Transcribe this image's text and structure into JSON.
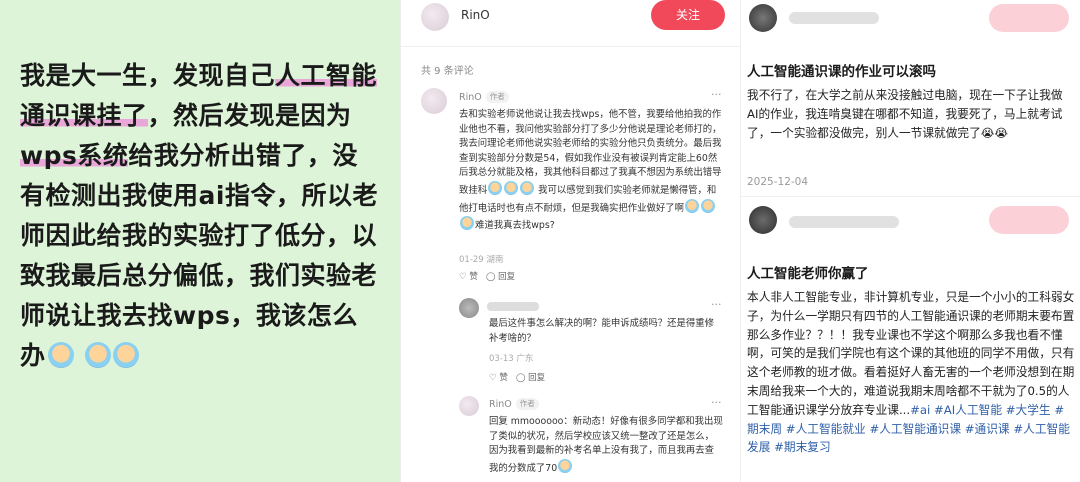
{
  "left_panel": {
    "parts": [
      {
        "t": "我是大一生，发现自己",
        "hl": false
      },
      {
        "t": "人工智能通识课挂了",
        "hl": true
      },
      {
        "t": "，然后发现是因为",
        "hl": false
      },
      {
        "t": "wps系统",
        "hl": true
      },
      {
        "t": "给我分析出错了，没有检测出我使用ai指令，所以老师因此给我的实验打了低分，以致我最后总分偏低，我们实验老师说让我去找wps，我该怎么办",
        "hl": false
      }
    ]
  },
  "middle": {
    "author": "RinO",
    "follow_label": "关注",
    "comment_count": "共 9 条评论",
    "comments": [
      {
        "name": "RinO",
        "tag": "作者",
        "body": "去和实验老师说他说让我去找wps，他不管，我要给他拍我的作业他也不看，我问他实验部分打了多少分他说是理论老师打的，我去问理论老师他说实验老师给的实验分他只负责统分。最后我查到实验部分分数是54，假如我作业没有被误判肯定能上60然后我总分就能及格，我其他科目都过了我真不想因为系统出错导致挂科",
        "body2": "我可以感觉到我们实验老师就是懒得管，和他打电话时也有点不耐烦，但是我确实把作业做好了啊",
        "body3": "难道我真去找wps?",
        "meta": "01-29 湖南",
        "like": "赞",
        "reply": "回复"
      },
      {
        "body": "最后这件事怎么解决的啊？能申诉成绩吗？还是得重修补考啥的？",
        "meta": "03-13 广东",
        "like": "赞",
        "reply": "回复"
      },
      {
        "name": "RinO",
        "tag": "作者",
        "body": "回复 mmoooooo：新动态！好像有很多同学都和我出现了类似的状况，然后学校应该又统一整改了还是怎么，因为我看到最新的补考名单上没有我了，而且我再去查我的分数成了70"
      }
    ]
  },
  "right": {
    "post1": {
      "title": "人工智能通识课的作业可以滚吗",
      "body": "我不行了，在大学之前从来没接触过电脑，现在一下子让我做AI的作业，我连啃臭键在哪都不知道，我要死了，马上就考试了，一个实验都没做完，别人一节课就做完了😭😭",
      "date": "2025-12-04"
    },
    "post2": {
      "title": "人工智能老师你赢了",
      "body": "本人非人工智能专业，非计算机专业，只是一个小小的工科弱女子，为什么一学期只有四节的人工智能通识课的老师期末要布置那么多作业？？！！我专业课也不学这个啊那么多我也看不懂啊，可笑的是我们学院也有这个课的其他班的同学不用做，只有这个老师教的班才做。看着挺好人畜无害的一个老师没想到在期末周给我来一个大的，难道说我期末周啥都不干就为了0.5的人工智能通识课学分放弃专业课...",
      "tags": [
        "#ai",
        "#AI人工智能",
        "#大学生",
        "#期末周",
        "#人工智能就业",
        "#人工智能通识课",
        "#通识课",
        "#人工智能发展",
        "#期末复习"
      ]
    }
  }
}
